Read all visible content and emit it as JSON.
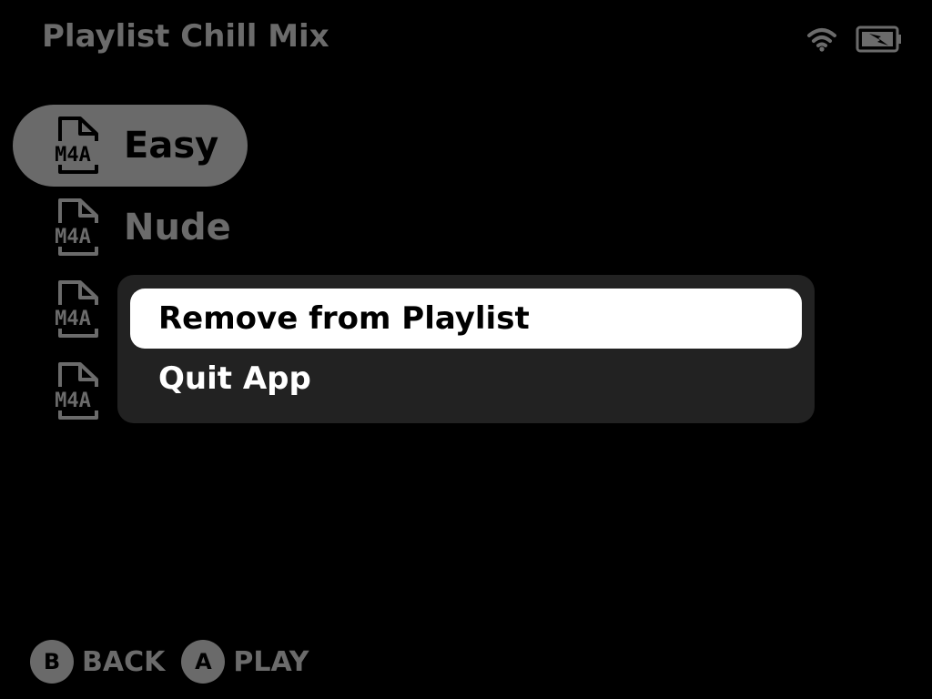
{
  "header": {
    "title": "Playlist Chill Mix",
    "wifi_icon": "wifi-icon",
    "battery_icon": "battery-charging-icon"
  },
  "tracks": [
    {
      "label": "Easy",
      "icon": "m4a-file-icon",
      "icon_text": "M4A",
      "selected": true
    },
    {
      "label": "Nude",
      "icon": "m4a-file-icon",
      "icon_text": "M4A",
      "selected": false
    },
    {
      "label": "",
      "icon": "m4a-file-icon",
      "icon_text": "M4A",
      "selected": false
    },
    {
      "label": "",
      "icon": "m4a-file-icon",
      "icon_text": "M4A",
      "selected": false
    }
  ],
  "context_menu": {
    "items": [
      {
        "label": "Remove from Playlist",
        "active": true
      },
      {
        "label": "Quit App",
        "active": false
      }
    ]
  },
  "footer": {
    "back": {
      "button": "B",
      "label": "BACK"
    },
    "play": {
      "button": "A",
      "label": "PLAY"
    }
  },
  "colors": {
    "background": "#000000",
    "dim_text": "#6b6b6b",
    "selection": "#6a6a6a",
    "menu_bg": "#222222",
    "menu_active": "#ffffff"
  }
}
